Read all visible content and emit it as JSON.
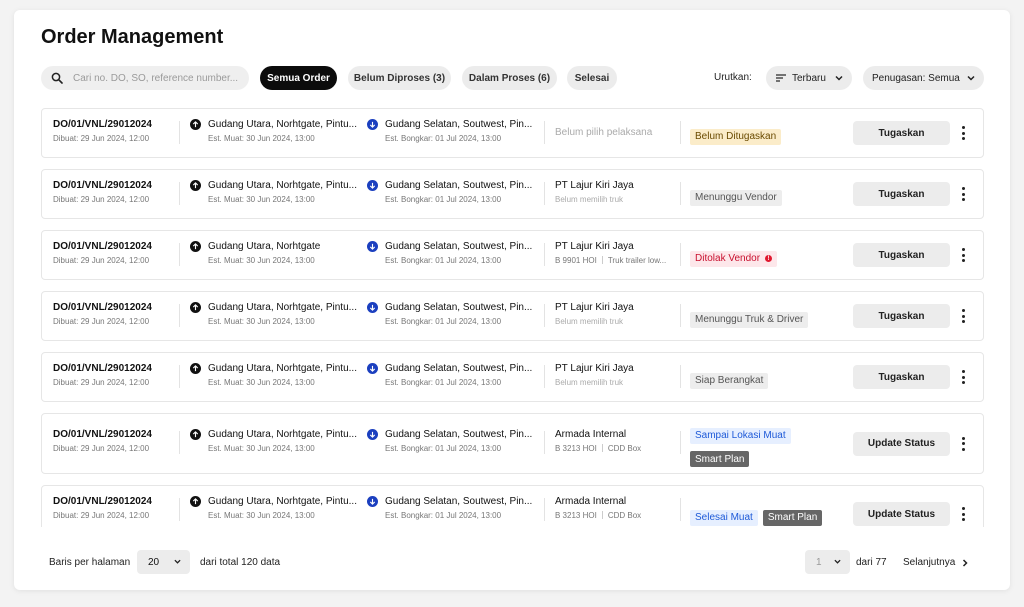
{
  "page": {
    "title": "Order Management"
  },
  "search": {
    "placeholder": "Cari no. DO, SO, reference number..."
  },
  "filters": [
    {
      "label": "Semua Order",
      "active": true
    },
    {
      "label": "Belum Diproses (3)",
      "active": false
    },
    {
      "label": "Dalam Proses (6)",
      "active": false
    },
    {
      "label": "Selesai",
      "active": false
    }
  ],
  "sort": {
    "label": "Urutkan:",
    "value": "Terbaru",
    "assign": "Penugasan: Semua"
  },
  "orders": [
    {
      "do": "DO/01/VNL/29012024",
      "created": "Dibuat:  29 Jun 2024, 12:00",
      "origin": "Gudang Utara, Norhtgate, Pintu...",
      "load": "Est. Muat: 30 Jun 2024, 13:00",
      "dest": "Gudang Selatan, Soutwest, Pin...",
      "unload": "Est. Bongkar: 01 Jul 2024, 13:00",
      "vendor": "Belum pilih pelaksana",
      "truck": "",
      "truck_type": "",
      "status": "Belum Ditugaskan",
      "status_color": "#fbecc9",
      "extra": "",
      "action": "Tugaskan"
    },
    {
      "do": "DO/01/VNL/29012024",
      "created": "Dibuat:  29 Jun 2024, 12:00",
      "origin": "Gudang Utara, Norhtgate, Pintu...",
      "load": "Est. Muat: 30 Jun 2024, 13:00",
      "dest": "Gudang Selatan, Soutwest, Pin...",
      "unload": "Est. Bongkar: 01 Jul 2024, 13:00",
      "vendor": "PT Lajur Kiri Jaya",
      "truck": "Belum memilih truk",
      "truck_type": "",
      "status": "Menunggu Vendor",
      "status_color": "#ededed",
      "extra": "",
      "action": "Tugaskan"
    },
    {
      "do": "DO/01/VNL/29012024",
      "created": "Dibuat:  29 Jun 2024, 12:00",
      "origin": "Gudang Utara, Norhtgate",
      "load": "Est. Muat: 30 Jun 2024, 13:00",
      "dest": "Gudang Selatan, Soutwest, Pin...",
      "unload": "Est. Bongkar: 01 Jul 2024, 13:00",
      "vendor": "PT Lajur Kiri Jaya",
      "truck": "B 9901 HOI",
      "truck_type": "Truk trailer low...",
      "status": "Ditolak Vendor",
      "status_color": "#fde7ea",
      "extra": "",
      "action": "Tugaskan"
    },
    {
      "do": "DO/01/VNL/29012024",
      "created": "Dibuat:  29 Jun 2024, 12:00",
      "origin": "Gudang Utara, Norhtgate, Pintu...",
      "load": "Est. Muat: 30 Jun 2024, 13:00",
      "dest": "Gudang Selatan, Soutwest, Pin...",
      "unload": "Est. Bongkar: 01 Jul 2024, 13:00",
      "vendor": "PT Lajur Kiri Jaya",
      "truck": "Belum memilih truk",
      "truck_type": "",
      "status": "Menunggu Truk & Driver",
      "status_color": "#ededed",
      "extra": "",
      "action": "Tugaskan"
    },
    {
      "do": "DO/01/VNL/29012024",
      "created": "Dibuat:  29 Jun 2024, 12:00",
      "origin": "Gudang Utara, Norhtgate, Pintu...",
      "load": "Est. Muat: 30 Jun 2024, 13:00",
      "dest": "Gudang Selatan, Soutwest, Pin...",
      "unload": "Est. Bongkar: 01 Jul 2024, 13:00",
      "vendor": "PT Lajur Kiri Jaya",
      "truck": "Belum memilih truk",
      "truck_type": "",
      "status": "Siap Berangkat",
      "status_color": "#ededed",
      "extra": "",
      "action": "Tugaskan"
    },
    {
      "do": "DO/01/VNL/29012024",
      "created": "Dibuat:  29 Jun 2024, 12:00",
      "origin": "Gudang Utara, Norhtgate, Pintu...",
      "load": "Est. Muat: 30 Jun 2024, 13:00",
      "dest": "Gudang Selatan, Soutwest, Pin...",
      "unload": "Est. Bongkar: 01 Jul 2024, 13:00",
      "vendor": "Armada Internal",
      "truck": "B 3213 HOI",
      "truck_type": "CDD Box",
      "status": "Sampai Lokasi Muat",
      "status_color": "#e6efff",
      "extra": "Smart Plan",
      "action": "Update Status"
    },
    {
      "do": "DO/01/VNL/29012024",
      "created": "Dibuat:  29 Jun 2024, 12:00",
      "origin": "Gudang Utara, Norhtgate, Pintu...",
      "load": "Est. Muat: 30 Jun 2024, 13:00",
      "dest": "Gudang Selatan, Soutwest, Pin...",
      "unload": "Est. Bongkar: 01 Jul 2024, 13:00",
      "vendor": "Armada Internal",
      "truck": "B 3213 HOI",
      "truck_type": "CDD Box",
      "status": "Selesai Muat",
      "status_color": "#e6efff",
      "extra": "Smart Plan",
      "action": "Update Status"
    }
  ],
  "footer": {
    "rows_label": "Baris per halaman",
    "rows_value": "20",
    "total": "dari total 120 data",
    "page_value": "1",
    "page_of": "dari 77",
    "next": "Selanjutnya"
  },
  "colors": {
    "upload_icon": "#111111",
    "download_icon": "#1b3fbf",
    "active_chip": "#0c0c0c"
  }
}
